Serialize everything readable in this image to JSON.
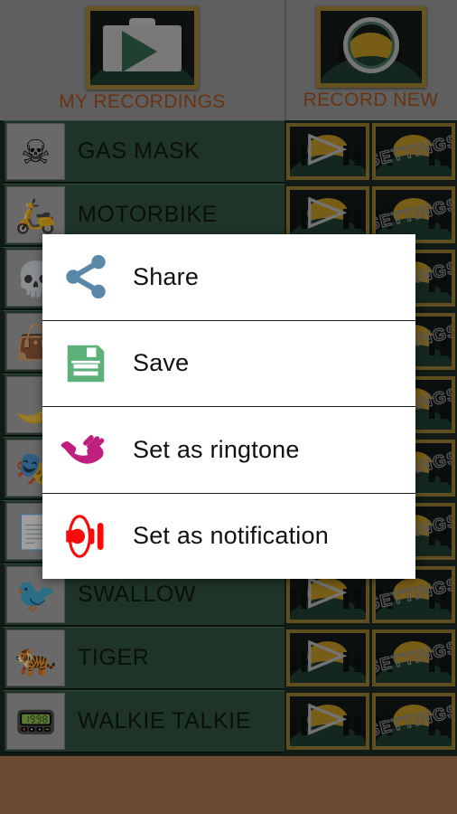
{
  "header": {
    "my_recordings": {
      "label": "MY RECORDINGS",
      "icon": "briefcase-play-icon"
    },
    "record_new": {
      "label": "RECORD NEW",
      "icon": "magnifier-ring-icon"
    },
    "label_color": "#b5500f",
    "background_color": "#9a9a9a"
  },
  "list": {
    "row_background": "#2b5640",
    "rows": [
      {
        "name": "GAS MASK",
        "thumb": "gas-mask-thumb",
        "glyph": "☠"
      },
      {
        "name": "MOTORBIKE",
        "thumb": "motorbike-thumb",
        "glyph": "🛵"
      },
      {
        "name": "",
        "thumb": "grim-reaper-thumb",
        "glyph": "💀"
      },
      {
        "name": "",
        "thumb": "shopping-bag-thumb",
        "glyph": "👜"
      },
      {
        "name": "",
        "thumb": "night-sky-thumb",
        "glyph": "🌙"
      },
      {
        "name": "",
        "thumb": "theatre-stage-thumb",
        "glyph": "🎭"
      },
      {
        "name": "",
        "thumb": "paper-thumb",
        "glyph": "📄"
      },
      {
        "name": "SWALLOW",
        "thumb": "swallow-bird-thumb",
        "glyph": "🐦"
      },
      {
        "name": "TIGER",
        "thumb": "tiger-thumb",
        "glyph": "🐅"
      },
      {
        "name": "WALKIE TALKIE",
        "thumb": "walkie-talkie-thumb",
        "glyph": "📟"
      }
    ],
    "action_play_label": "",
    "action_settings_label": "SETTINGS"
  },
  "dialog": {
    "items": [
      {
        "label": "Share",
        "icon": "share-icon",
        "color": "#5b87a8"
      },
      {
        "label": "Save",
        "icon": "floppy-disk-icon",
        "color": "#5cb07a"
      },
      {
        "label": "Set as ringtone",
        "icon": "ringing-phone-icon",
        "color": "#bf1f7f"
      },
      {
        "label": "Set as notification",
        "icon": "speaker-wave-icon",
        "color": "#fb0a0a"
      }
    ]
  },
  "colors": {
    "page_background": "#6b4a33",
    "list_background": "#1c2b21",
    "frame_border": "#a8862c"
  }
}
